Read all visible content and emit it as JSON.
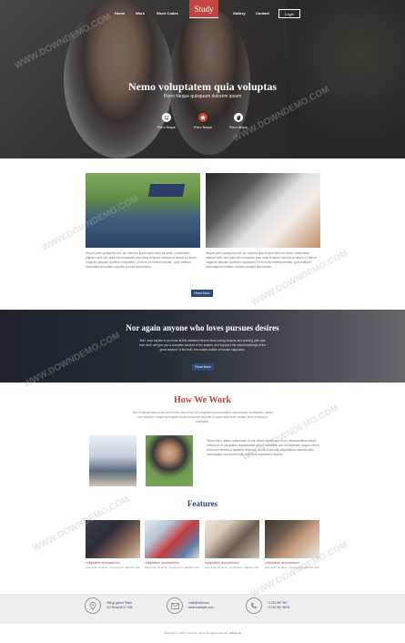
{
  "nav": {
    "items": [
      "Home",
      "Work",
      "Short Codes",
      "Gallery",
      "Contact"
    ],
    "login": "Login",
    "logo": "Study"
  },
  "hero": {
    "title": "Nemo voluptatem quia voluptas",
    "subtitle": "Porro Neque quisquam dolorem ipsum",
    "features": [
      {
        "label": "Porro Neque",
        "icon": "smile-icon"
      },
      {
        "label": "Porro Neque",
        "icon": "star-badge-icon"
      },
      {
        "label": "Porro Neque",
        "icon": "hand-icon"
      }
    ]
  },
  "cards": [
    {
      "text": "Neque porro quisquam est, qui dolorem ipsum quia dolor sit amet, consectetur, adipisci velit, sed quia non numquam eius modi tempora incidunt ut labore et dolore magnam aliquam quaerat voluptatem. Ut enim ad minima veniam, quis nostrum exercitationem ullam corporis suscipit laboriosam."
    },
    {
      "text": "Neque porro quisquam est, qui dolorem ipsum quia dolor sit amet, consectetur, adipisci velit, sed quia non numquam eius modi tempora incidunt ut labore et dolore magnam aliquam quaerat voluptatem. Ut enim ad minima veniam, quis nostrum exercitationem ullam corporis suscipit laboriosam."
    }
  ],
  "read_more": "Read More",
  "band": {
    "title": "Nor again anyone who loves pursues desires",
    "text": "But I must explain to you how all this mistaken idea of denouncing pleasure and praising pain was born and I will give you a complete account of the system, and expound the actual teachings of the great explorer of the truth, the master-builder of human happiness.",
    "button": "Read More"
  },
  "how_we_work": {
    "title": "How We Work",
    "subtitle": "Sed ut perspiciatis unde omnis iste natus error sit voluptatem accusantium doloremque laudantium, totam rem aperiam, eaque ipsa quae ab illo inventore veritatis et quasi architecto beatae vitae dicta sunt explicabo.",
    "text": "Temporibus autem quibusdam et aut officiis debitis aut rerum necessitatibus saepe eveniet ut et voluptates repudiandae sint et molestiae non recusandae. Itaque earum rerum hic tenetur a sapiente delectus, ut aut reiciendis voluptatibus maiores alias consequatur aut perferendis doloribus asperiores repellat."
  },
  "features": {
    "title": "Features",
    "items": [
      {
        "title": "voluptatem accusantium",
        "text": "quia dolor sit amet, consectetur, adipisci velit"
      },
      {
        "title": "voluptatem accusantium",
        "text": "quia dolor sit amet, consectetur, adipisci velit"
      },
      {
        "title": "voluptatem accusantium",
        "text": "quia dolor sit amet, consectetur, adipisci velit"
      },
      {
        "title": "voluptatem accusantium",
        "text": "quia dolor sit amet, consectetur, adipisci velit"
      }
    ]
  },
  "contact": {
    "address": [
      "756 gt globel Place",
      "CD-Road,M 07 435."
    ],
    "email": [
      "mail@mail.com",
      "www.example.com"
    ],
    "phone": [
      "+1234 567 567",
      "+1234 567 6578"
    ]
  },
  "footer": {
    "copyright": "Copyright © 2015 Company name All rights reserved. ",
    "brand": "w3layouts"
  },
  "watermark": "WWW.DOWNDEMO.COM",
  "colors": {
    "accent_red": "#c2453f",
    "accent_blue": "#2c4a74"
  }
}
